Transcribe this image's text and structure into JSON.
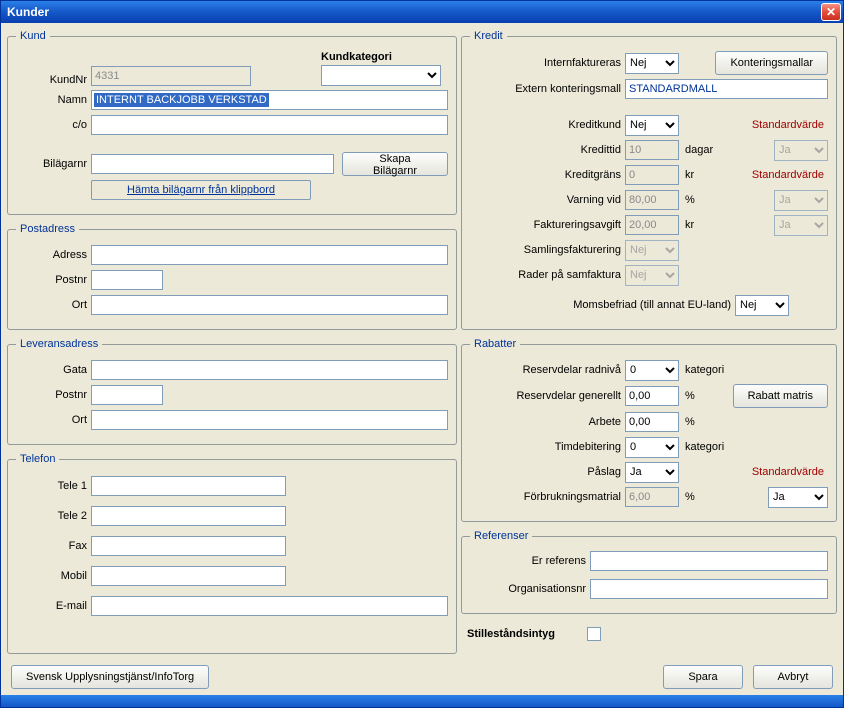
{
  "window": {
    "title": "Kunder"
  },
  "kund": {
    "legend": "Kund",
    "kundnr_label": "KundNr",
    "kundnr_value": "4331",
    "kundkategori_label": "Kundkategori",
    "kundkategori_value": "",
    "namn_label": "Namn",
    "namn_value": "INTERNT BACKJOBB VERKSTAD",
    "co_label": "c/o",
    "co_value": "",
    "bilagarnr_label": "Bilägarnr",
    "bilagarnr_value": "",
    "skapa_btn": "Skapa Bilägarnr",
    "hamta_link": "Hämta bilägarnr från klippbord"
  },
  "postadress": {
    "legend": "Postadress",
    "adress_label": "Adress",
    "adress_value": "",
    "postnr_label": "Postnr",
    "postnr_value": "",
    "ort_label": "Ort",
    "ort_value": ""
  },
  "leveransadress": {
    "legend": "Leveransadress",
    "gata_label": "Gata",
    "gata_value": "",
    "postnr_label": "Postnr",
    "postnr_value": "",
    "ort_label": "Ort",
    "ort_value": ""
  },
  "telefon": {
    "legend": "Telefon",
    "tele1_label": "Tele 1",
    "tele1_value": "",
    "tele2_label": "Tele 2",
    "tele2_value": "",
    "fax_label": "Fax",
    "fax_value": "",
    "mobil_label": "Mobil",
    "mobil_value": "",
    "email_label": "E-mail",
    "email_value": ""
  },
  "kredit": {
    "legend": "Kredit",
    "internfaktureras_label": "Internfaktureras",
    "internfaktureras_value": "Nej",
    "konteringsmallar_btn": "Konteringsmallar",
    "extern_label": "Extern konteringsmall",
    "extern_value": "STANDARDMALL",
    "kreditkund_label": "Kreditkund",
    "kreditkund_value": "Nej",
    "kredittid_label": "Kredittid",
    "kredittid_value": "10",
    "kredittid_unit": "dagar",
    "kreditgrans_label": "Kreditgräns",
    "kreditgrans_value": "0",
    "kreditgrans_unit": "kr",
    "varning_label": "Varning vid",
    "varning_value": "80,00",
    "varning_unit": "%",
    "faktavgift_label": "Faktureringsavgift",
    "faktavgift_value": "20,00",
    "faktavgift_unit": "kr",
    "samlings_label": "Samlingsfakturering",
    "samlings_value": "Nej",
    "rader_label": "Rader på samfaktura",
    "rader_value": "Nej",
    "moms_label": "Momsbefriad (till annat EU-land)",
    "moms_value": "Nej",
    "standardvarde": "Standardvärde",
    "std_ja": "Ja"
  },
  "rabatter": {
    "legend": "Rabatter",
    "reservradniva_label": "Reservdelar radnivå",
    "reservradniva_value": "0",
    "reservradniva_unit": "kategori",
    "reservgenerellt_label": "Reservdelar generellt",
    "reservgenerellt_value": "0,00",
    "reservgenerellt_unit": "%",
    "rabattmatris_btn": "Rabatt matris",
    "arbete_label": "Arbete",
    "arbete_value": "0,00",
    "arbete_unit": "%",
    "timdebitering_label": "Timdebitering",
    "timdebitering_value": "0",
    "timdebitering_unit": "kategori",
    "paslag_label": "Påslag",
    "paslag_value": "Ja",
    "forbrukning_label": "Förbrukningsmatrial",
    "forbrukning_value": "6,00",
    "forbrukning_unit": "%",
    "standardvarde": "Standardvärde",
    "std_ja": "Ja"
  },
  "referenser": {
    "legend": "Referenser",
    "erreferens_label": "Er referens",
    "erreferens_value": "",
    "orgnr_label": "Organisationsnr",
    "orgnr_value": ""
  },
  "stillestand": {
    "label": "Stilleståndsintyg"
  },
  "bottom": {
    "infotorg_btn": "Svensk Upplysningstjänst/InfoTorg",
    "spara_btn": "Spara",
    "avbryt_btn": "Avbryt"
  }
}
